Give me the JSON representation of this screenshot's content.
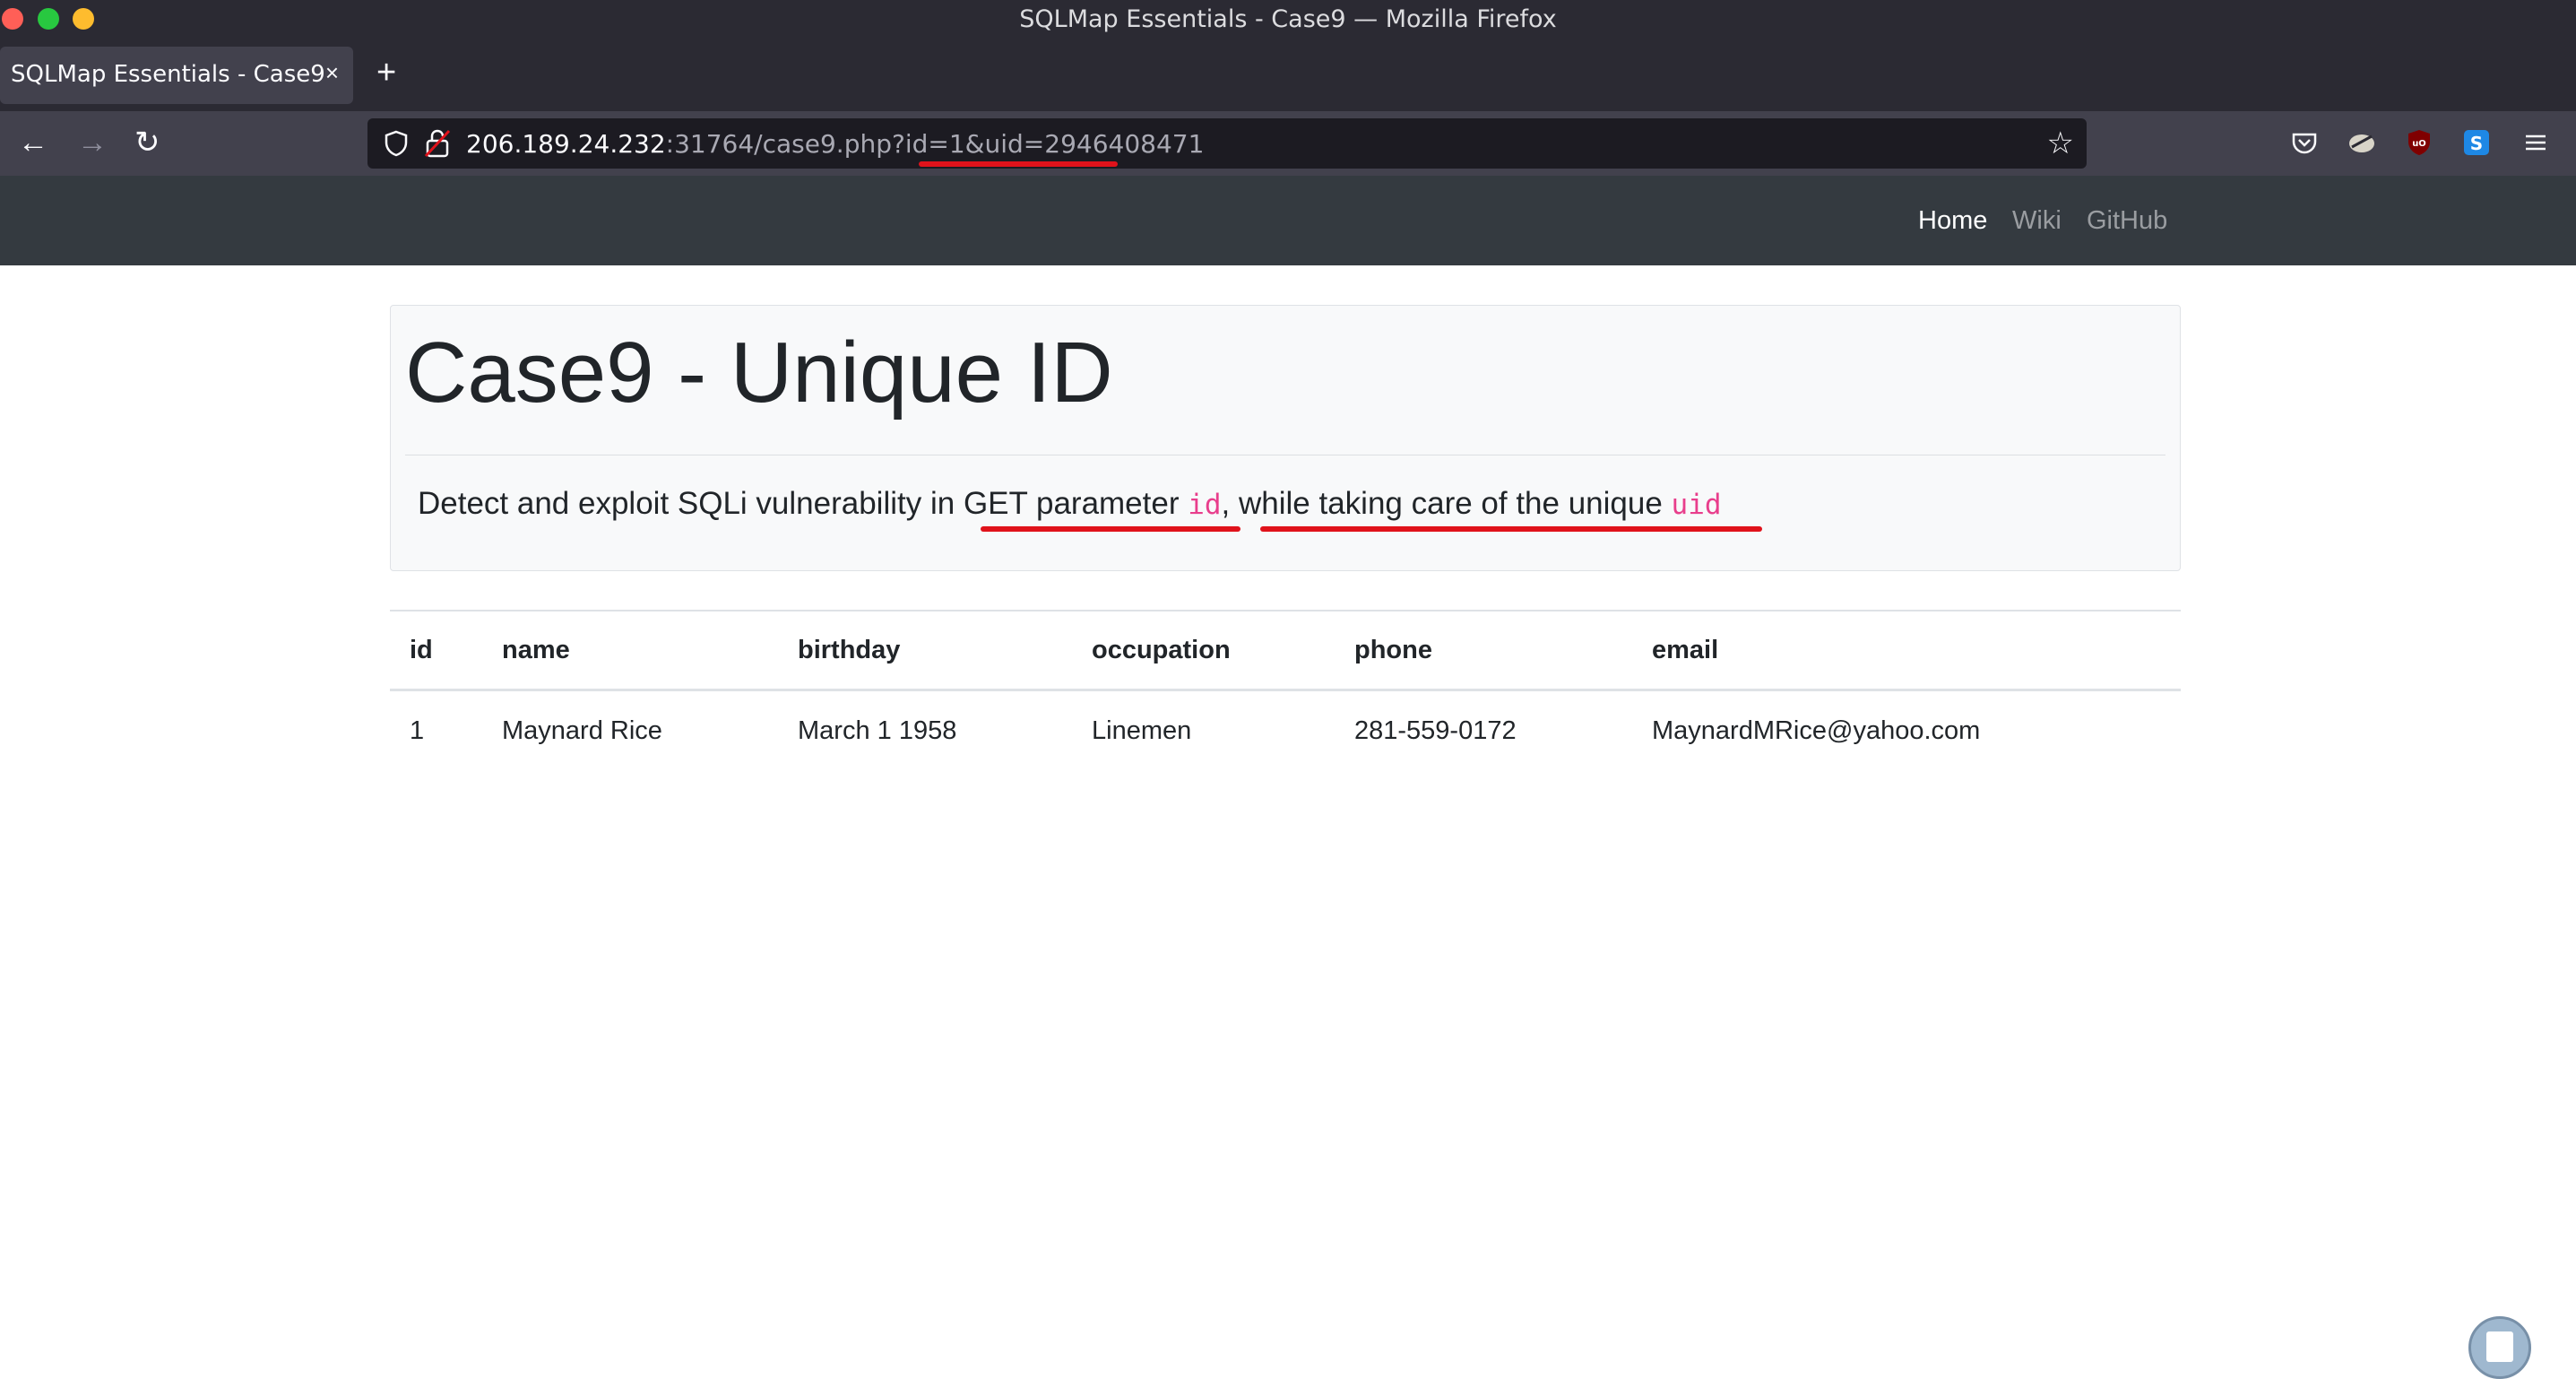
{
  "window": {
    "title": "SQLMap Essentials - Case9 — Mozilla Firefox"
  },
  "tab": {
    "title": "SQLMap Essentials - Case9",
    "close": "×",
    "new_tab": "+"
  },
  "toolbar": {
    "back": "←",
    "forward": "→",
    "reload": "↻",
    "bookmark_star": "☆"
  },
  "url": {
    "host": "206.189.24.232",
    "path": ":31764/case9.php?id=1&uid=2946408471"
  },
  "site_nav": {
    "links": [
      "Home",
      "Wiki",
      "GitHub"
    ]
  },
  "jumbotron": {
    "title": "Case9 - Unique ID",
    "desc_prefix": "Detect and exploit SQLi vulnerability in ",
    "desc_get": "GET parameter ",
    "desc_code_id": "id",
    "desc_comma": ",",
    "desc_while": " while taking care of the unique ",
    "desc_code_uid": "uid"
  },
  "table": {
    "headers": [
      "id",
      "name",
      "birthday",
      "occupation",
      "phone",
      "email"
    ],
    "rows": [
      [
        "1",
        "Maynard Rice",
        "March 1 1958",
        "Linemen",
        "281-559-0172",
        "MaynardMRice@yahoo.com"
      ]
    ]
  },
  "colors": {
    "annotation_red": "#e0121b",
    "code_pink": "#e83e8c",
    "site_nav_bg": "#343a40"
  }
}
